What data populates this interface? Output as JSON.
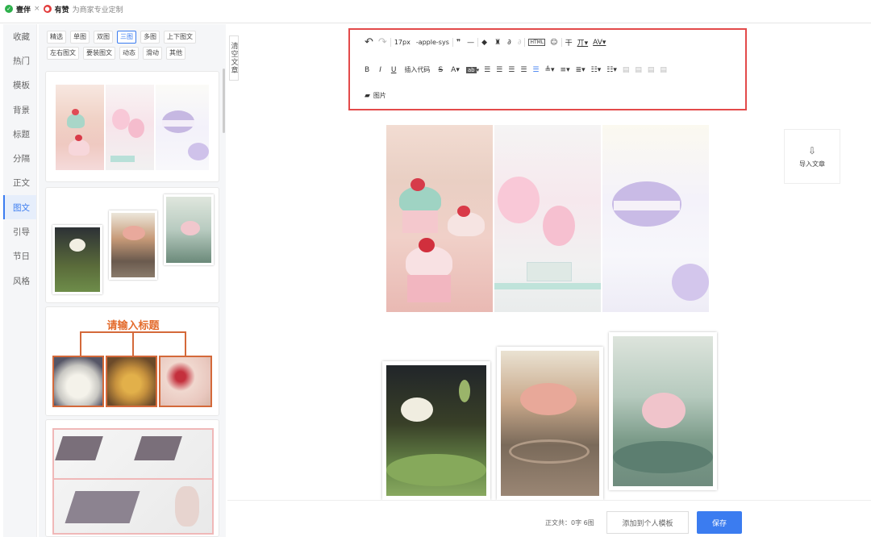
{
  "top": {
    "app1": "壹伴",
    "app2": "有赞",
    "desc": "为商家专业定制"
  },
  "sidebar": {
    "items": [
      {
        "label": "收藏"
      },
      {
        "label": "热门"
      },
      {
        "label": "模板"
      },
      {
        "label": "背景"
      },
      {
        "label": "标题"
      },
      {
        "label": "分隔"
      },
      {
        "label": "正文"
      },
      {
        "label": "图文",
        "active": true
      },
      {
        "label": "引导"
      },
      {
        "label": "节日"
      },
      {
        "label": "风格"
      }
    ]
  },
  "filters": [
    "精选",
    "单图",
    "双图",
    "三图",
    "多图",
    "上下图文",
    "左右图文",
    "要装图文",
    "动态",
    "滑动",
    "其他"
  ],
  "active_filter": "三图",
  "cards": {
    "title_card": "请输入标题"
  },
  "quick_action": "清空文章",
  "toolbar": {
    "font_size": "17px",
    "font_family": "-apple-sys",
    "insert_code": "插入代码",
    "image": "图片"
  },
  "right_panel": {
    "import": "导入文章"
  },
  "footer": {
    "count": "正文共：0字 6图",
    "add_template": "添加到个人模板",
    "save": "保存"
  }
}
